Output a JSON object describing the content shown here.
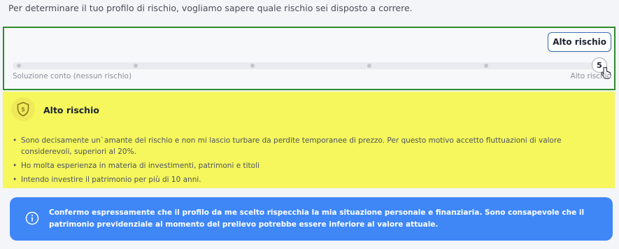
{
  "intro_text": "Per determinare il tuo profilo di rischio, vogliamo sapere quale rischio sei disposto a correre.",
  "slider": {
    "tooltip_label": "Alto rischio",
    "selected_value": "5",
    "min_label": "Soluzione conto (nessun rischio)",
    "max_label": "Alto rischio",
    "steps": 6
  },
  "risk_card": {
    "icon_name": "shield-5-icon",
    "icon_number": "5",
    "title": "Alto rischio",
    "bullets": [
      "Sono decisamente un`amante del rischio e non mi lascio turbare da perdite temporanee di prezzo. Per questo motivo accetto fluttuazioni di valore considerevoli, superiori al 20%.",
      "Ho molta esperienza in materia di investimenti, patrimoni e titoli",
      "Intendo investire il patrimonio per più di 10 anni."
    ],
    "background_color": "#f5f75c"
  },
  "info_banner": {
    "icon_name": "info-icon",
    "text": "Confermo espressamente che il profilo da me scelto rispecchia la mia situazione personale e finanziaria. Sono consapevole che il patrimonio previdenziale al momento del prelievo potrebbe essere inferiore al valore attuale.",
    "background_color": "#3f87f7"
  }
}
